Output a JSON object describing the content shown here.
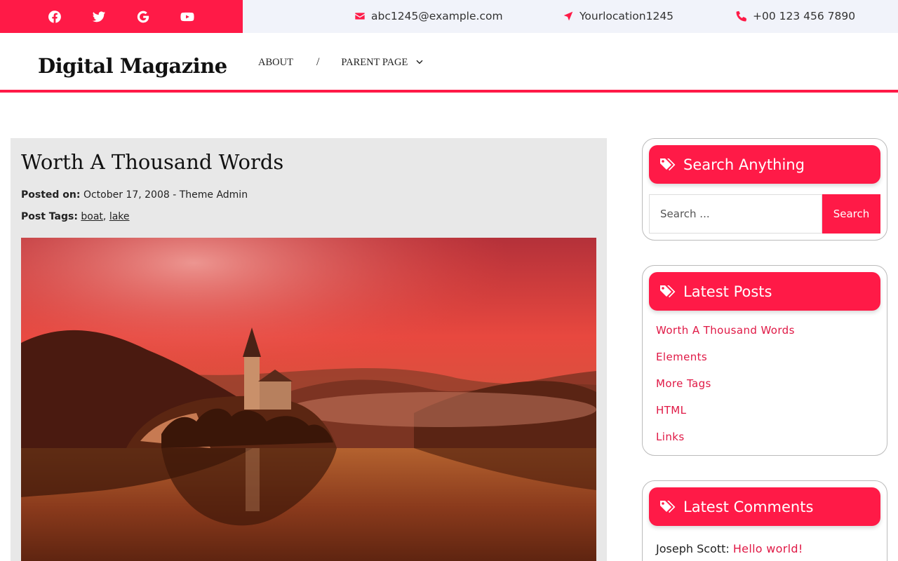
{
  "topbar": {
    "social": [
      "facebook-icon",
      "twitter-icon",
      "google-icon",
      "youtube-icon"
    ],
    "email": "abc1245@example.com",
    "location": "Yourlocation1245",
    "phone": "+00 123 456 7890"
  },
  "header": {
    "brand": "Digital Magazine",
    "nav": {
      "about": "ABOUT",
      "separator": "/",
      "parent_page": "PARENT PAGE"
    }
  },
  "article": {
    "title": "Worth A Thousand Words",
    "posted_label": "Posted on:",
    "posted_value": "October 17, 2008 - Theme Admin",
    "tags_label": "Post Tags:",
    "tags": [
      "boat",
      "lake"
    ]
  },
  "sidebar": {
    "search": {
      "title": "Search Anything",
      "placeholder": "Search ...",
      "button": "Search"
    },
    "latest_posts": {
      "title": "Latest Posts",
      "items": [
        "Worth A Thousand Words",
        "Elements",
        "More Tags",
        "HTML",
        "Links"
      ]
    },
    "latest_comments": {
      "title": "Latest Comments",
      "author": "Joseph Scott:",
      "link": "Hello world!"
    }
  },
  "colors": {
    "accent": "#ff1a47",
    "link": "#e01845",
    "contact_bar": "#f1f3fa",
    "article_bg": "#e8e8e8"
  }
}
